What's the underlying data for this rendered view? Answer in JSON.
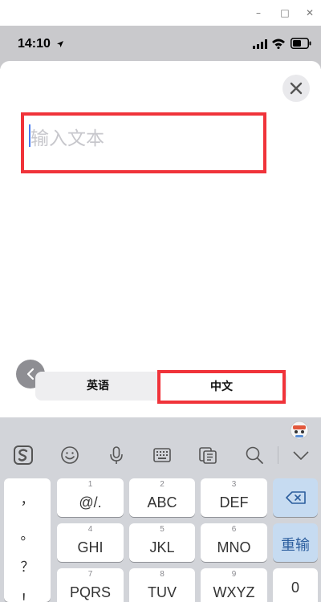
{
  "window": {
    "minimize_glyph": "–",
    "maximize_glyph": "□",
    "close_glyph": "✕"
  },
  "status_bar": {
    "time": "14:10",
    "icons": [
      "location-arrow-icon",
      "signal-icon",
      "wifi-icon",
      "battery-icon"
    ]
  },
  "editor": {
    "placeholder": "输入文本",
    "close_icon": "close-icon",
    "highlight_color": "#f0333a"
  },
  "language_toggle": {
    "options": [
      "英语",
      "中文"
    ],
    "selected": "中文"
  },
  "keyboard": {
    "toolbar_icons": [
      "sogou-logo-icon",
      "emoji-icon",
      "microphone-icon",
      "keyboard-icon",
      "clipboard-icon",
      "search-icon",
      "collapse-keyboard-icon"
    ],
    "punctuation": [
      "，",
      "。",
      "？",
      "！"
    ],
    "keys": [
      {
        "num": "1",
        "label": "@/."
      },
      {
        "num": "2",
        "label": "ABC"
      },
      {
        "num": "3",
        "label": "DEF"
      },
      {
        "num": "4",
        "label": "GHI"
      },
      {
        "num": "5",
        "label": "JKL"
      },
      {
        "num": "6",
        "label": "MNO"
      },
      {
        "num": "7",
        "label": "PQRS"
      },
      {
        "num": "8",
        "label": "TUV"
      },
      {
        "num": "9",
        "label": "WXYZ"
      }
    ],
    "delete_icon": "backspace-icon",
    "reenter_label": "重输",
    "zero_label": "0"
  }
}
